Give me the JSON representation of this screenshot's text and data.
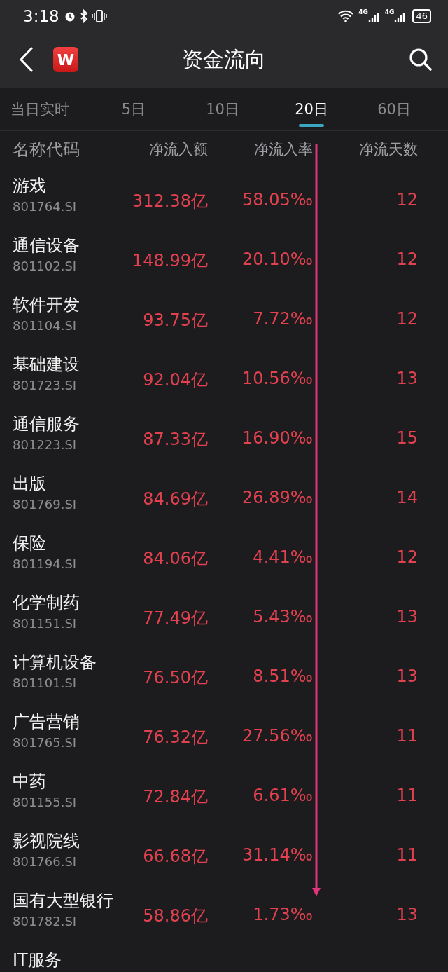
{
  "status_bar": {
    "time": "3:18",
    "network_1": "4G",
    "network_2": "4G",
    "battery": "46"
  },
  "header": {
    "logo": "W",
    "title": "资金流向"
  },
  "tabs": [
    {
      "label": "当日实时",
      "selected": false
    },
    {
      "label": "5日",
      "selected": false
    },
    {
      "label": "10日",
      "selected": false
    },
    {
      "label": "20日",
      "selected": true
    },
    {
      "label": "60日",
      "selected": false
    }
  ],
  "table": {
    "columns": [
      "名称代码",
      "净流入额",
      "净流入率",
      "净流天数"
    ],
    "rows": [
      {
        "name": "游戏",
        "code": "801764.SI",
        "amount": "312.38亿",
        "rate": "58.05‰",
        "days": "12"
      },
      {
        "name": "通信设备",
        "code": "801102.SI",
        "amount": "148.99亿",
        "rate": "20.10‰",
        "days": "12"
      },
      {
        "name": "软件开发",
        "code": "801104.SI",
        "amount": "93.75亿",
        "rate": "7.72‰",
        "days": "12"
      },
      {
        "name": "基础建设",
        "code": "801723.SI",
        "amount": "92.04亿",
        "rate": "10.56‰",
        "days": "13"
      },
      {
        "name": "通信服务",
        "code": "801223.SI",
        "amount": "87.33亿",
        "rate": "16.90‰",
        "days": "15"
      },
      {
        "name": "出版",
        "code": "801769.SI",
        "amount": "84.69亿",
        "rate": "26.89‰",
        "days": "14"
      },
      {
        "name": "保险",
        "code": "801194.SI",
        "amount": "84.06亿",
        "rate": "4.41‰",
        "days": "12"
      },
      {
        "name": "化学制药",
        "code": "801151.SI",
        "amount": "77.49亿",
        "rate": "5.43‰",
        "days": "13"
      },
      {
        "name": "计算机设备",
        "code": "801101.SI",
        "amount": "76.50亿",
        "rate": "8.51‰",
        "days": "13"
      },
      {
        "name": "广告营销",
        "code": "801765.SI",
        "amount": "76.32亿",
        "rate": "27.56‰",
        "days": "11"
      },
      {
        "name": "中药",
        "code": "801155.SI",
        "amount": "72.84亿",
        "rate": "6.61‰",
        "days": "11"
      },
      {
        "name": "影视院线",
        "code": "801766.SI",
        "amount": "66.68亿",
        "rate": "31.14‰",
        "days": "11"
      },
      {
        "name": "国有大型银行",
        "code": "801782.SI",
        "amount": "58.86亿",
        "rate": "1.73‰",
        "days": "13"
      },
      {
        "name": "IT服务"
      }
    ]
  }
}
